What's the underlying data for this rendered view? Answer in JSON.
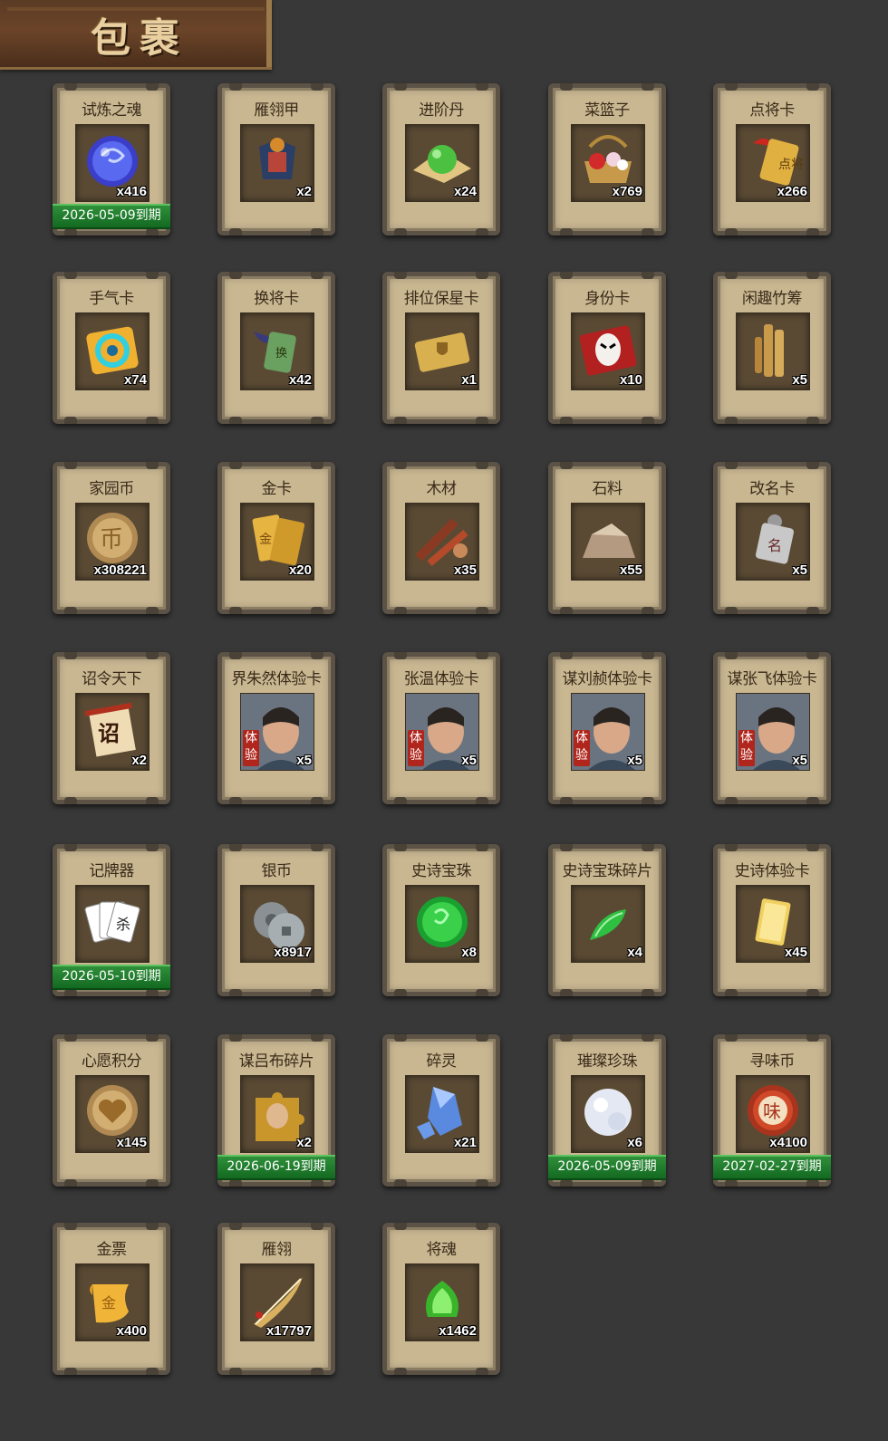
{
  "title": "包裹",
  "colors": {
    "card_bg": "#c9b792",
    "expire_green": "#1f7f2c",
    "background": "#383838"
  },
  "items": [
    {
      "name": "试炼之魂",
      "count": "x416",
      "expire": "2026-05-09到期",
      "icon": "blue-dragon-orb-icon"
    },
    {
      "name": "雁翎甲",
      "count": "x2",
      "expire": "",
      "icon": "armor-icon"
    },
    {
      "name": "进阶丹",
      "count": "x24",
      "expire": "",
      "icon": "green-pill-icon"
    },
    {
      "name": "菜篮子",
      "count": "x769",
      "expire": "",
      "icon": "flower-basket-icon"
    },
    {
      "name": "点将卡",
      "count": "x266",
      "expire": "",
      "icon": "general-card-icon"
    },
    {
      "name": "手气卡",
      "count": "x74",
      "expire": "",
      "icon": "luck-card-icon"
    },
    {
      "name": "换将卡",
      "count": "x42",
      "expire": "",
      "icon": "swap-general-card-icon"
    },
    {
      "name": "排位保星卡",
      "count": "x1",
      "expire": "",
      "icon": "rank-shield-card-icon"
    },
    {
      "name": "身份卡",
      "count": "x10",
      "expire": "",
      "icon": "opera-mask-card-icon"
    },
    {
      "name": "闲趣竹筹",
      "count": "x5",
      "expire": "",
      "icon": "bamboo-tally-icon"
    },
    {
      "name": "家园币",
      "count": "x308221",
      "expire": "",
      "icon": "home-coin-icon"
    },
    {
      "name": "金卡",
      "count": "x20",
      "expire": "",
      "icon": "gold-card-icon"
    },
    {
      "name": "木材",
      "count": "x35",
      "expire": "",
      "icon": "wood-icon"
    },
    {
      "name": "石料",
      "count": "x55",
      "expire": "",
      "icon": "stone-icon"
    },
    {
      "name": "改名卡",
      "count": "x5",
      "expire": "",
      "icon": "rename-card-icon"
    },
    {
      "name": "诏令天下",
      "count": "x2",
      "expire": "",
      "icon": "edict-scroll-icon"
    },
    {
      "name": "界朱然体验卡",
      "count": "x5",
      "expire": "",
      "icon": "hero-portrait-icon",
      "trial": "体验"
    },
    {
      "name": "张温体验卡",
      "count": "x5",
      "expire": "",
      "icon": "hero-portrait-icon",
      "trial": "体验"
    },
    {
      "name": "谋刘赪体验卡",
      "count": "x5",
      "expire": "",
      "icon": "hero-portrait-icon",
      "trial": "体验"
    },
    {
      "name": "谋张飞体验卡",
      "count": "x5",
      "expire": "",
      "icon": "hero-portrait-icon",
      "trial": "体验"
    },
    {
      "name": "记牌器",
      "count": "",
      "expire": "2026-05-10到期",
      "icon": "playing-cards-icon"
    },
    {
      "name": "银币",
      "count": "x8917",
      "expire": "",
      "icon": "silver-coin-icon"
    },
    {
      "name": "史诗宝珠",
      "count": "x8",
      "expire": "",
      "icon": "epic-orb-icon"
    },
    {
      "name": "史诗宝珠碎片",
      "count": "x4",
      "expire": "",
      "icon": "orb-shard-icon"
    },
    {
      "name": "史诗体验卡",
      "count": "x45",
      "expire": "",
      "icon": "epic-trial-card-icon"
    },
    {
      "name": "心愿积分",
      "count": "x145",
      "expire": "",
      "icon": "heart-coin-icon"
    },
    {
      "name": "谋吕布碎片",
      "count": "x2",
      "expire": "2026-06-19到期",
      "icon": "puzzle-piece-icon"
    },
    {
      "name": "碎灵",
      "count": "x21",
      "expire": "",
      "icon": "blue-crystal-icon"
    },
    {
      "name": "璀璨珍珠",
      "count": "x6",
      "expire": "2026-05-09到期",
      "icon": "pearl-icon"
    },
    {
      "name": "寻味币",
      "count": "x4100",
      "expire": "2027-02-27到期",
      "icon": "flavor-coin-icon"
    },
    {
      "name": "金票",
      "count": "x400",
      "expire": "",
      "icon": "gold-ticket-icon"
    },
    {
      "name": "雁翎",
      "count": "x17797",
      "expire": "",
      "icon": "feather-icon"
    },
    {
      "name": "将魂",
      "count": "x1462",
      "expire": "",
      "icon": "green-soul-icon"
    }
  ]
}
